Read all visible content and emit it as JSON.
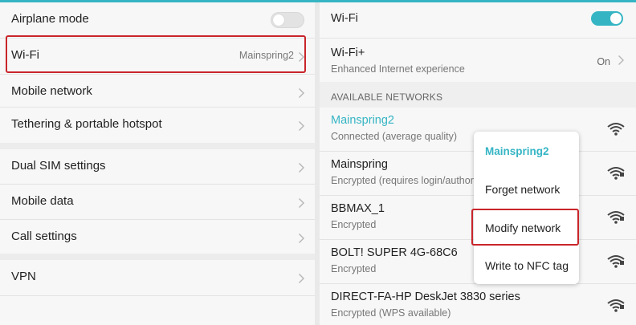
{
  "colors": {
    "accent": "#35b5c4",
    "highlight": "#c9252b",
    "secondary_text": "#777777"
  },
  "settings": {
    "items": [
      {
        "label": "Airplane mode",
        "control": "toggle-off"
      },
      {
        "label": "Wi-Fi",
        "value": "Mainspring2"
      },
      {
        "label": "Mobile network"
      },
      {
        "label": "Tethering & portable hotspot"
      },
      {
        "label": "Dual SIM settings"
      },
      {
        "label": "Mobile data"
      },
      {
        "label": "Call settings"
      },
      {
        "label": "VPN"
      }
    ]
  },
  "wifi": {
    "title": "Wi-Fi",
    "wifi_plus": {
      "title": "Wi-Fi+",
      "subtitle": "Enhanced Internet experience",
      "status": "On"
    },
    "section_header": "AVAILABLE NETWORKS",
    "networks": [
      {
        "name": "Mainspring2",
        "status": "Connected (average quality)"
      },
      {
        "name": "Mainspring",
        "status": "Encrypted (requires login/authori"
      },
      {
        "name": "BBMAX_1",
        "status": "Encrypted"
      },
      {
        "name": "BOLT! SUPER 4G-68C6",
        "status": "Encrypted"
      },
      {
        "name": "DIRECT-FA-HP DeskJet 3830 series",
        "status": "Encrypted (WPS available)"
      }
    ]
  },
  "context_menu": {
    "title": "Mainspring2",
    "items": [
      "Forget network",
      "Modify network",
      "Write to NFC tag"
    ]
  },
  "icons": {
    "chevron": "chevron-right-icon",
    "wifi": "wifi-signal-icon"
  }
}
